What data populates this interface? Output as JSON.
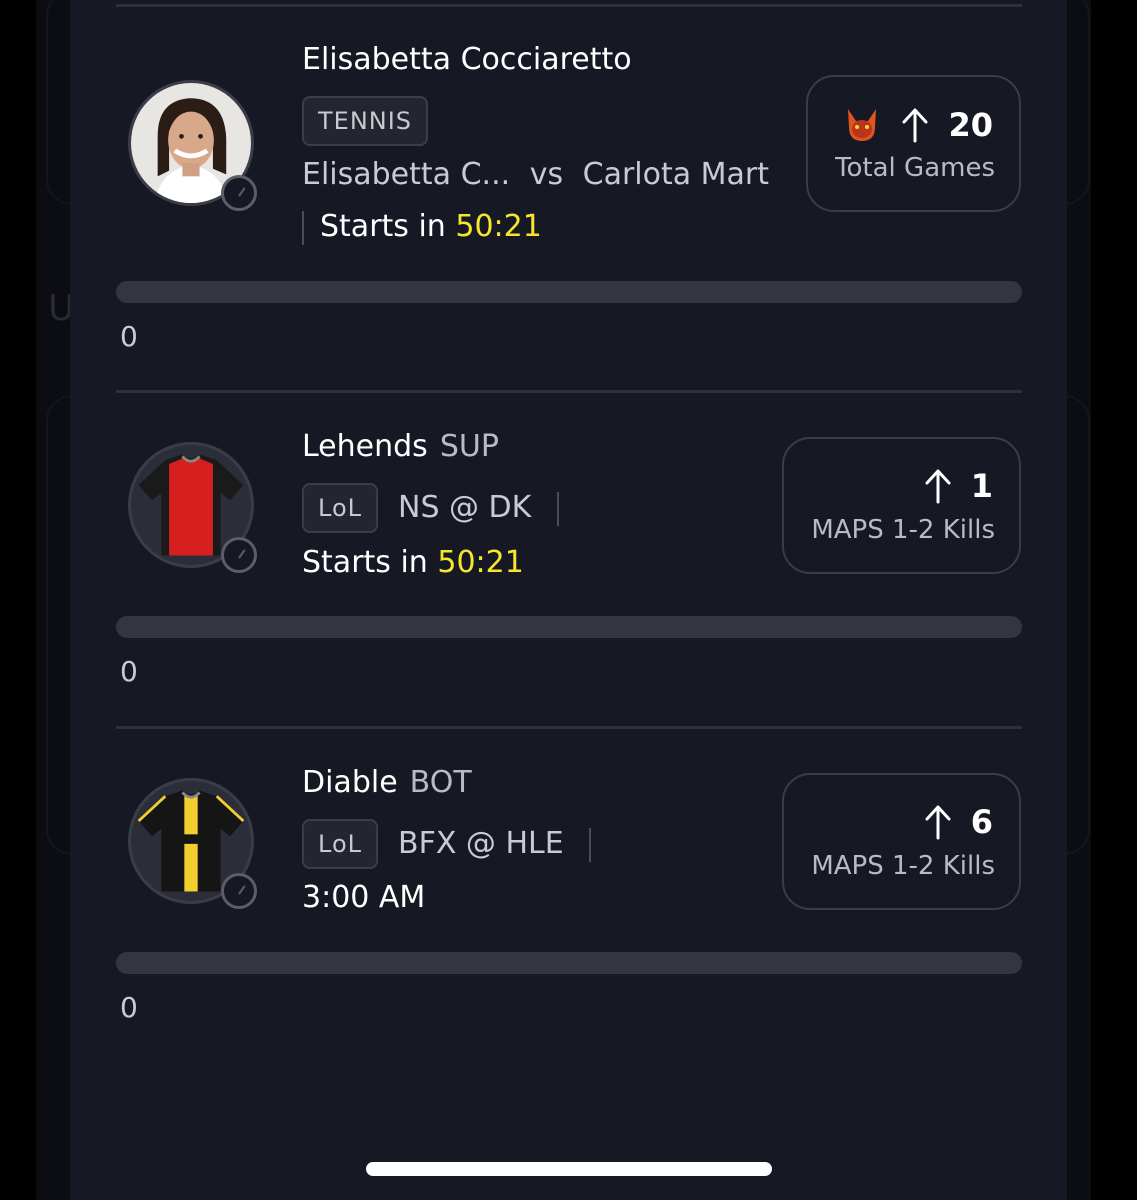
{
  "picks": [
    {
      "player": "Elisabetta Cocciaretto",
      "position": "",
      "league": "TENNIS",
      "matchup_left": "Elisabetta C...",
      "matchup_vs": "vs",
      "matchup_right": "Carlota Mart",
      "starts_prefix": "Starts in",
      "starts_time": "50:21",
      "direction": "↑",
      "line": "20",
      "stat": "Total Games",
      "has_demon": true,
      "progress_fraction": 0,
      "progress_count": "0"
    },
    {
      "player": "Lehends",
      "position": "SUP",
      "league": "LoL",
      "matchup": "NS @ DK",
      "starts_prefix": "Starts in",
      "starts_time": "50:21",
      "direction": "↑",
      "line": "1",
      "stat": "MAPS 1-2 Kills",
      "jersey_colors": [
        "#d61f1f",
        "#1a1a1a"
      ],
      "progress_fraction": 0,
      "progress_count": "0"
    },
    {
      "player": "Diable",
      "position": "BOT",
      "league": "LoL",
      "matchup": "BFX @ HLE",
      "time": "3:00 AM",
      "direction": "↑",
      "line": "6",
      "stat": "MAPS 1-2 Kills",
      "jersey_colors": [
        "#151515",
        "#f2cf2f"
      ],
      "progress_fraction": 0,
      "progress_count": "0"
    }
  ],
  "colors": {
    "accent_yellow": "#f7e72b",
    "sheet_bg": "#161823",
    "page_bg": "#0c0d12"
  }
}
